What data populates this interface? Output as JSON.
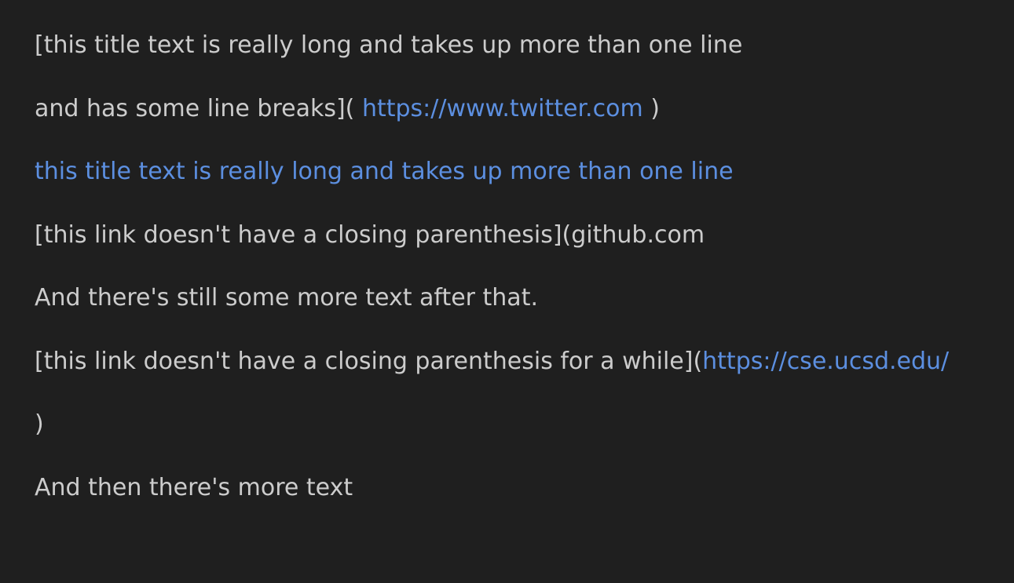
{
  "colors": {
    "background": "#1f1f1f",
    "text": "#cccccc",
    "link": "#5c8fe0"
  },
  "lines": {
    "line1": "[this title text is really long and takes up more than one line",
    "line2_prefix": "and has some line breaks](",
    "line2_link": "https://www.twitter.com",
    "line2_suffix": ")",
    "line3_link": "this title text is really long and takes up more than one line",
    "line4": "[this link doesn't have a closing parenthesis](github.com",
    "line5": "And there's still some more text after that.",
    "line6_prefix": "[this link doesn't have a closing parenthesis for a while](",
    "line6_link": "https://cse.ucsd.edu/",
    "line7": ")",
    "line8": "And then there's more text"
  }
}
